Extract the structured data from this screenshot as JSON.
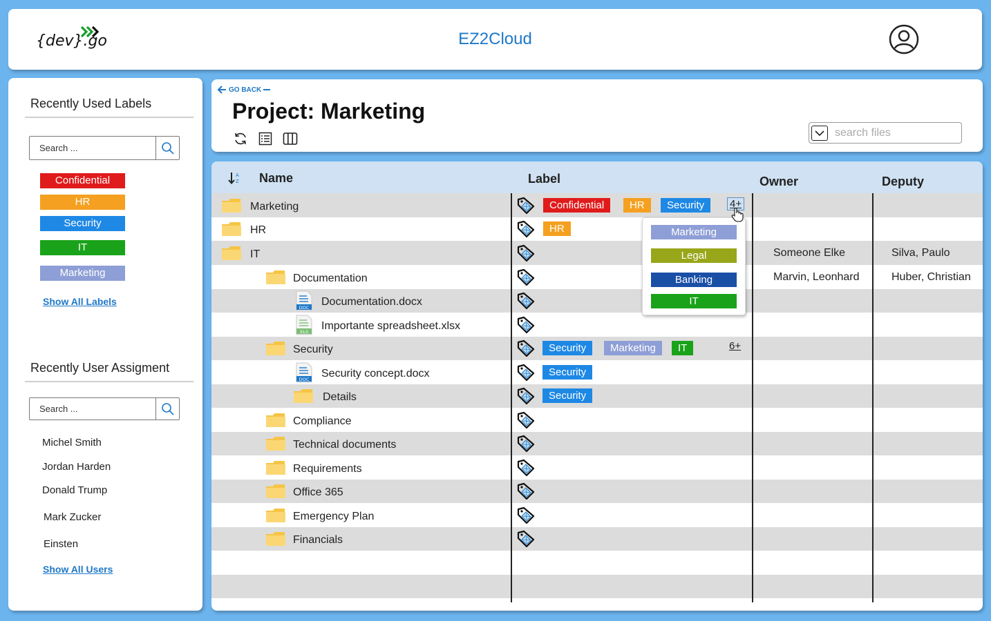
{
  "header": {
    "logo_text": "{dev}.go",
    "app_title": "EZ2Cloud",
    "avatar_icon": "user-circle-icon"
  },
  "sidebar": {
    "labels_heading": "Recently Used Labels",
    "labels_search_placeholder": "Search ...",
    "labels": [
      {
        "text": "Confidential",
        "color": "#e01b1b"
      },
      {
        "text": "HR",
        "color": "#f5a020"
      },
      {
        "text": "Security",
        "color": "#1e88e5"
      },
      {
        "text": "IT",
        "color": "#1aa31a"
      },
      {
        "text": "Marketing",
        "color": "#8e9ed6"
      }
    ],
    "show_all_labels": "Show All Labels",
    "users_heading": "Recently User Assigment",
    "users_search_placeholder": "Search ...",
    "users": [
      "Michel Smith",
      "Jordan Harden",
      "Donald Trump",
      "Mark Zucker",
      "Einsten"
    ],
    "show_all_users": "Show All Users"
  },
  "topbar": {
    "go_back": "GO BACK",
    "project_title": "Project: Marketing",
    "tools": [
      "refresh-icon",
      "list-view-icon",
      "column-view-icon"
    ],
    "search_placeholder": "search files"
  },
  "table": {
    "headers": {
      "name": "Name",
      "label": "Label",
      "owner": "Owner",
      "deputy": "Deputy"
    },
    "rows": [
      {
        "name": "Marketing",
        "type": "folder",
        "level": 0,
        "labels": [
          "Confidential",
          "HR",
          "Security"
        ],
        "more": "4+",
        "owner": "",
        "deputy": ""
      },
      {
        "name": "HR",
        "type": "folder",
        "level": 0,
        "labels": [
          "HR"
        ],
        "more": "",
        "owner": "",
        "deputy": ""
      },
      {
        "name": "IT",
        "type": "folder",
        "level": 0,
        "labels": [],
        "more": "",
        "owner": "Someone Elke",
        "deputy": "Silva, Paulo"
      },
      {
        "name": "Documentation",
        "type": "folder",
        "level": 1,
        "labels": [],
        "more": "",
        "owner": "Marvin, Leonhard",
        "deputy": "Huber, Christian"
      },
      {
        "name": "Documentation.docx",
        "type": "doc",
        "level": 2,
        "labels": [],
        "more": "",
        "owner": "",
        "deputy": ""
      },
      {
        "name": "Importante spreadsheet.xlsx",
        "type": "xls",
        "level": 2,
        "labels": [],
        "more": "",
        "owner": "",
        "deputy": ""
      },
      {
        "name": "Security",
        "type": "folder",
        "level": 1,
        "labels": [
          "Security",
          "Marketing",
          "IT"
        ],
        "more": "6+",
        "owner": "",
        "deputy": ""
      },
      {
        "name": "Security concept.docx",
        "type": "doc",
        "level": 2,
        "labels": [
          "Security"
        ],
        "more": "",
        "owner": "",
        "deputy": ""
      },
      {
        "name": "Details",
        "type": "folder",
        "level": 2,
        "labels": [
          "Security"
        ],
        "more": "",
        "owner": "",
        "deputy": ""
      },
      {
        "name": "Compliance",
        "type": "folder",
        "level": 1,
        "labels": [],
        "more": "",
        "owner": "",
        "deputy": ""
      },
      {
        "name": "Technical documents",
        "type": "folder",
        "level": 1,
        "labels": [],
        "more": "",
        "owner": "",
        "deputy": ""
      },
      {
        "name": "Requirements",
        "type": "folder",
        "level": 1,
        "labels": [],
        "more": "",
        "owner": "",
        "deputy": ""
      },
      {
        "name": "Office 365",
        "type": "folder",
        "level": 1,
        "labels": [],
        "more": "",
        "owner": "",
        "deputy": ""
      },
      {
        "name": "Emergency Plan",
        "type": "folder",
        "level": 1,
        "labels": [],
        "more": "",
        "owner": "",
        "deputy": ""
      },
      {
        "name": "Financials",
        "type": "folder",
        "level": 1,
        "labels": [],
        "more": "",
        "owner": "",
        "deputy": ""
      }
    ]
  },
  "label_colors": {
    "Confidential": "#e01b1b",
    "HR": "#f5a020",
    "Security": "#1e88e5",
    "IT": "#1aa31a",
    "Marketing": "#8e9ed6",
    "Legal": "#98a619",
    "Banking": "#1a4fa6"
  },
  "popup": {
    "labels": [
      "Marketing",
      "Legal",
      "Banking",
      "IT"
    ]
  }
}
